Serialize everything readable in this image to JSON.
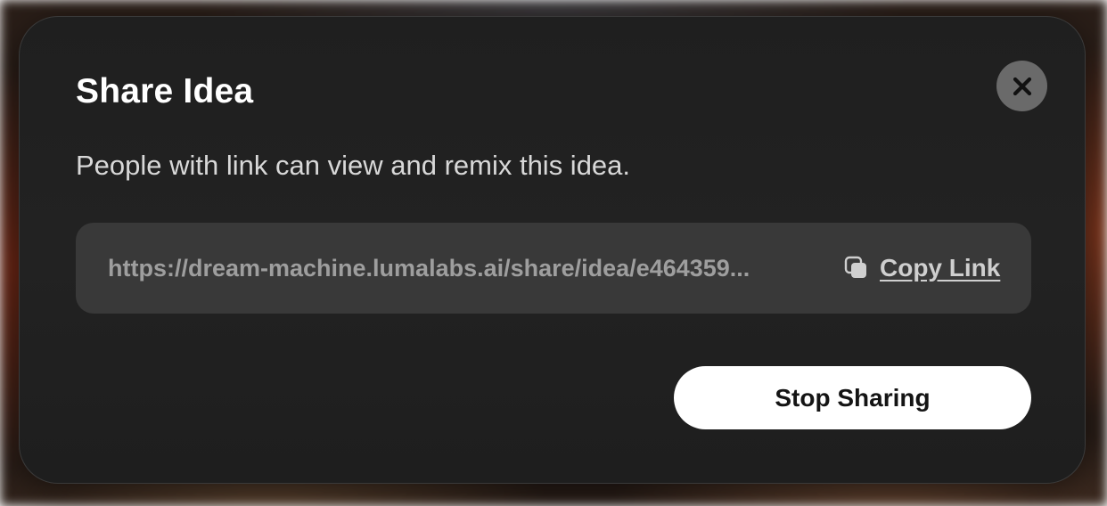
{
  "dialog": {
    "title": "Share Idea",
    "description": "People with link can view and remix this idea.",
    "share_url": "https://dream-machine.lumalabs.ai/share/idea/e464359...",
    "copy_link_label": "Copy Link",
    "stop_sharing_label": "Stop Sharing",
    "close_icon": "close-icon",
    "copy_icon": "copy-icon"
  },
  "colors": {
    "dialog_bg": "#202020",
    "link_box_bg": "#393939",
    "close_button_bg": "#6a6a6a",
    "primary_button_bg": "#ffffff",
    "primary_button_text": "#141414"
  }
}
